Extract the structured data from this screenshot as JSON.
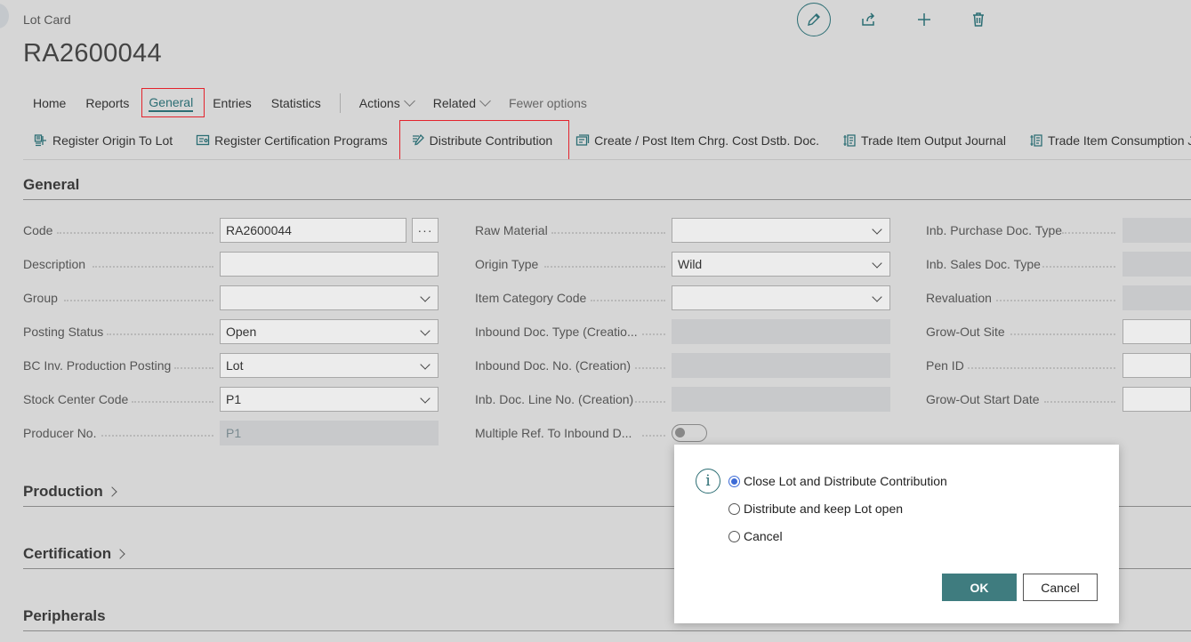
{
  "header": {
    "caption": "Lot Card",
    "title": "RA2600044",
    "icons": [
      "edit-icon",
      "share-icon",
      "add-icon",
      "delete-icon"
    ]
  },
  "tabs": [
    {
      "label": "Home"
    },
    {
      "label": "Reports"
    },
    {
      "label": "General",
      "active": true
    },
    {
      "label": "Entries"
    },
    {
      "label": "Statistics"
    },
    {
      "label": "Actions"
    },
    {
      "label": "Related"
    },
    {
      "label": "Fewer options"
    }
  ],
  "actions": [
    {
      "label": "Register Origin To Lot",
      "icon": "register-origin-icon"
    },
    {
      "label": "Register Certification Programs",
      "icon": "certificate-icon"
    },
    {
      "label": "Distribute Contribution",
      "icon": "distribute-icon"
    },
    {
      "label": "Create / Post Item Chrg. Cost Dstb. Doc.",
      "icon": "post-document-icon"
    },
    {
      "label": "Trade Item Output Journal",
      "icon": "journal-icon"
    },
    {
      "label": "Trade Item Consumption Jo",
      "icon": "journal-icon"
    }
  ],
  "sections": {
    "general": "General",
    "production": "Production",
    "certification": "Certification",
    "peripherals": "Peripherals"
  },
  "fields": {
    "col1": [
      {
        "label": "Code",
        "value": "RA2600044",
        "kind": "lookup"
      },
      {
        "label": "Description",
        "value": "",
        "kind": "text"
      },
      {
        "label": "Group",
        "value": "",
        "kind": "dropdown"
      },
      {
        "label": "Posting Status",
        "value": "Open",
        "kind": "dropdown"
      },
      {
        "label": "BC Inv. Production Posting",
        "value": "Lot",
        "kind": "dropdown"
      },
      {
        "label": "Stock Center Code",
        "value": "P1",
        "kind": "dropdown"
      },
      {
        "label": "Producer No.",
        "value": "P1",
        "kind": "disabled"
      }
    ],
    "col2": [
      {
        "label": "Raw Material",
        "value": "",
        "kind": "dropdown"
      },
      {
        "label": "Origin Type",
        "value": "Wild",
        "kind": "dropdown"
      },
      {
        "label": "Item Category Code",
        "value": "",
        "kind": "dropdown"
      },
      {
        "label": "Inbound Doc. Type (Creatio...",
        "value": "",
        "kind": "disabled"
      },
      {
        "label": "Inbound Doc. No. (Creation)",
        "value": "",
        "kind": "disabled"
      },
      {
        "label": "Inb. Doc. Line No. (Creation)",
        "value": "",
        "kind": "disabled"
      },
      {
        "label": "Multiple Ref. To Inbound D...",
        "value": "",
        "kind": "toggle"
      }
    ],
    "col3": [
      {
        "label": "Inb. Purchase Doc. Type",
        "value": "",
        "kind": "disabled"
      },
      {
        "label": "Inb. Sales Doc. Type",
        "value": "",
        "kind": "disabled"
      },
      {
        "label": "Revaluation",
        "value": "",
        "kind": "disabled"
      },
      {
        "label": "Grow-Out Site",
        "value": "",
        "kind": "text"
      },
      {
        "label": "Pen ID",
        "value": "",
        "kind": "text"
      },
      {
        "label": "Grow-Out Start Date",
        "value": "",
        "kind": "text"
      }
    ]
  },
  "dialog": {
    "options": [
      {
        "label": "Close Lot and Distribute Contribution",
        "selected": true
      },
      {
        "label": "Distribute and keep Lot open",
        "selected": false
      },
      {
        "label": "Cancel",
        "selected": false
      }
    ],
    "ok_label": "OK",
    "cancel_label": "Cancel"
  },
  "colors": {
    "accent": "#2c6e74",
    "highlight": "#e3232c",
    "ok_button": "#3f7c7f",
    "radio_selected": "#3d6bd6"
  }
}
